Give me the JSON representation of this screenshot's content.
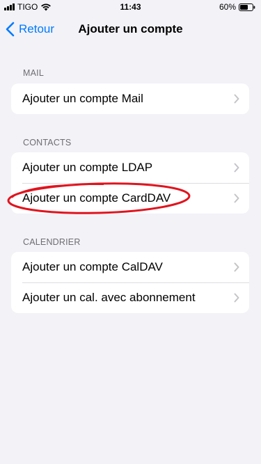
{
  "status_bar": {
    "carrier": "TIGO",
    "time": "11:43",
    "battery": "60%"
  },
  "nav": {
    "back_label": "Retour",
    "title": "Ajouter un compte"
  },
  "sections": {
    "mail": {
      "header": "MAIL",
      "rows": [
        "Ajouter un compte Mail"
      ]
    },
    "contacts": {
      "header": "CONTACTS",
      "rows": [
        "Ajouter un compte LDAP",
        "Ajouter un compte CardDAV"
      ]
    },
    "calendar": {
      "header": "CALENDRIER",
      "rows": [
        "Ajouter un compte CalDAV",
        "Ajouter un cal. avec abonnement"
      ]
    }
  },
  "annotation": {
    "highlight_color": "#e0141e",
    "highlighted_row": "Ajouter un compte CardDAV"
  },
  "colors": {
    "accent": "#007aff",
    "background": "#f2f2f7",
    "chevron": "#c4c4c7"
  }
}
